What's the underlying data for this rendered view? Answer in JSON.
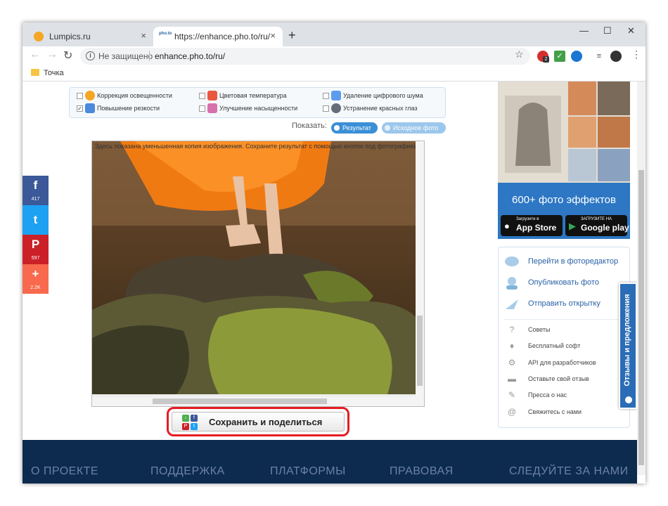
{
  "browser": {
    "tabs": [
      {
        "title": "Lumpics.ru",
        "close": "×"
      },
      {
        "title": "https://enhance.pho.to/ru/",
        "close": "×",
        "favicon": "pho.to"
      }
    ],
    "new_tab": "+",
    "window_controls": {
      "minimize": "—",
      "maximize": "☐",
      "close": "✕"
    },
    "nav": {
      "back": "←",
      "forward": "→",
      "reload": "↻"
    },
    "address": {
      "security_icon": "i",
      "security_text": "Не защищено",
      "url": "enhance.pho.to/ru/"
    },
    "star": "☆",
    "extensions": [
      {
        "name": "extension-red-icon",
        "badge": "2",
        "color": "#d32f2f"
      },
      {
        "name": "extension-check-icon",
        "color": "#43a047"
      },
      {
        "name": "extension-globe-icon",
        "color": "#1976d2"
      },
      {
        "name": "reading-list-icon",
        "color": "#555555"
      },
      {
        "name": "profile-avatar",
        "color": "#333333"
      }
    ],
    "menu": "⋮",
    "bookmarks": [
      {
        "label": "Точка"
      }
    ]
  },
  "options": [
    {
      "label": "Коррекция освещенности",
      "checked": false,
      "icon_color": "#f5a623"
    },
    {
      "label": "Цветовая температура",
      "checked": false,
      "icon_color": "#e9573f"
    },
    {
      "label": "Удаление цифрового шума",
      "checked": false,
      "icon_color": "#5d9cec"
    },
    {
      "label": "Повышение резкости",
      "checked": true,
      "icon_color": "#4a89dc"
    },
    {
      "label": "Улучшение насыщенности",
      "checked": false,
      "icon_color": "#d770ad"
    },
    {
      "label": "Устранение красных глаз",
      "checked": false,
      "icon_color": "#656d78"
    }
  ],
  "show": {
    "label": "Показать:",
    "result": "Результат",
    "original": "Исходное фото"
  },
  "image_note": "Здесь показана уменьшенная копия изображения. Сохраните результат с помощью кнопок под фотографией",
  "save_button": {
    "label": "Сохранить и поделиться"
  },
  "social": [
    {
      "name": "facebook",
      "icon": "f",
      "count": "417",
      "color": "#3b5998"
    },
    {
      "name": "twitter",
      "icon": "t",
      "count": "",
      "color": "#1da1f2"
    },
    {
      "name": "pinterest",
      "icon": "P",
      "count": "597",
      "color": "#cb2027"
    },
    {
      "name": "more",
      "icon": "+",
      "count": "2.2K",
      "color": "#f8694d"
    }
  ],
  "ad": {
    "title": "600+ фото эффектов",
    "app_store": {
      "top": "Загрузите в",
      "main": "App Store"
    },
    "google_play": {
      "top": "ЗАГРУЗИТЕ НА",
      "main": "Google play"
    }
  },
  "links_big": [
    {
      "label": "Перейти в фоторедактор"
    },
    {
      "label": "Опубликовать фото"
    },
    {
      "label": "Отправить открытку"
    }
  ],
  "links_small": [
    {
      "label": "Советы",
      "icon": "?"
    },
    {
      "label": "Бесплатный софт",
      "icon": "♦"
    },
    {
      "label": "API для разработчиков",
      "icon": "⚙"
    },
    {
      "label": "Оставьте свой отзыв",
      "icon": "▬"
    },
    {
      "label": "Пресса о нас",
      "icon": "✎"
    },
    {
      "label": "Свяжитесь с нами",
      "icon": "@"
    }
  ],
  "feedback_tab": "Отзывы и предложения",
  "footer": [
    {
      "label": "О ПРОЕКТЕ"
    },
    {
      "label": "ПОДДЕРЖКА"
    },
    {
      "label": "ПЛАТФОРМЫ"
    },
    {
      "label": "ПРАВОВАЯ"
    },
    {
      "label": "СЛЕДУЙТЕ ЗА НАМИ"
    }
  ]
}
